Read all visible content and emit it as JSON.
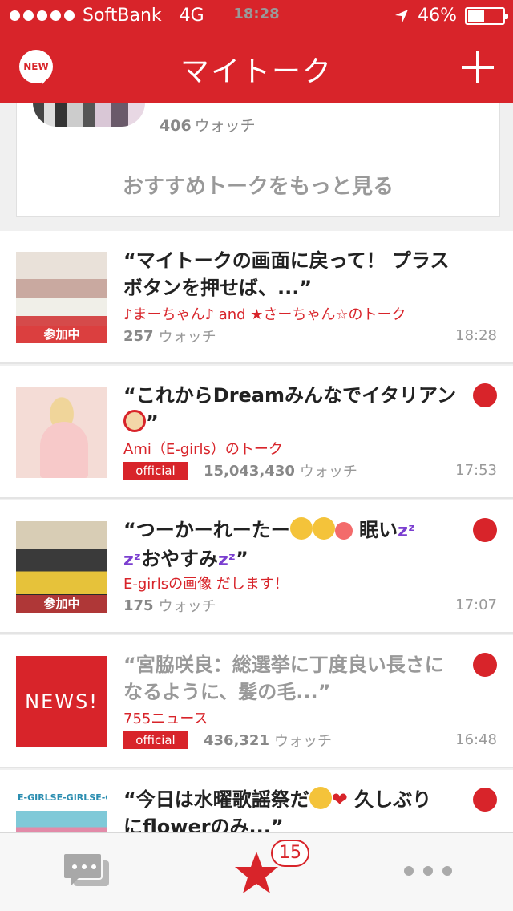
{
  "status_bar": {
    "carrier": "SoftBank",
    "network": "4G",
    "time": "18:28",
    "battery": "46%"
  },
  "header": {
    "new_badge": "NEW",
    "title": "マイトーク",
    "add_icon": "plus-icon"
  },
  "recommended": {
    "watch_count": "406",
    "watch_label": "ウォッチ",
    "more_label": "おすすめトークをもっと見る"
  },
  "talks": [
    {
      "title_line1": "“マイトークの画面に戻って！ プラス",
      "title_line2": "ボタンを押せば、...”",
      "owner": "♪まーちゃん♪ and ★さーちゃん☆のトーク",
      "watch_count": "257",
      "watch_label": "ウォッチ",
      "time": "18:28",
      "tag": "参加中",
      "unread": false,
      "official": false
    },
    {
      "title_line1": "“これからDreamみんなでイタリアン",
      "title_line2": "”",
      "owner": "Ami（E-girls）のトーク",
      "watch_count": "15,043,430",
      "watch_label": "ウォッチ",
      "time": "17:53",
      "official_label": "official",
      "unread": true,
      "official": true
    },
    {
      "title_line1": "“つーかーれーたー",
      "title_line1b": "眠い",
      "title_line2": "おやすみ",
      "title_line2_end": "”",
      "owner": "E-girlsの画像 だします！",
      "watch_count": "175",
      "watch_label": "ウォッチ",
      "time": "17:07",
      "tag": "参加中",
      "unread": true,
      "official": false
    },
    {
      "title_line1": "“宮脇咲良：総選挙に丁度良い長さに",
      "title_line2": "なるように、髪の毛...”",
      "owner": "755ニュース",
      "watch_count": "436,321",
      "watch_label": "ウォッチ",
      "time": "16:48",
      "official_label": "official",
      "thumb_text": "NEWS!",
      "unread": true,
      "official": true
    },
    {
      "title_line1": "“今日は水曜歌謡祭だ",
      "title_line1b": "久しぶり",
      "title_line2": "にflowerのみ...”",
      "thumb_text": "E-GIRLSE-GIRLSE-GIRLS",
      "unread": true,
      "official": false
    }
  ],
  "tabbar": {
    "chat_icon": "chat-bubbles-icon",
    "star_icon": "star-icon",
    "star_badge": "15",
    "more_icon": "more-dots-icon"
  },
  "colors": {
    "brand": "#d8242a",
    "text_muted": "#999999"
  }
}
